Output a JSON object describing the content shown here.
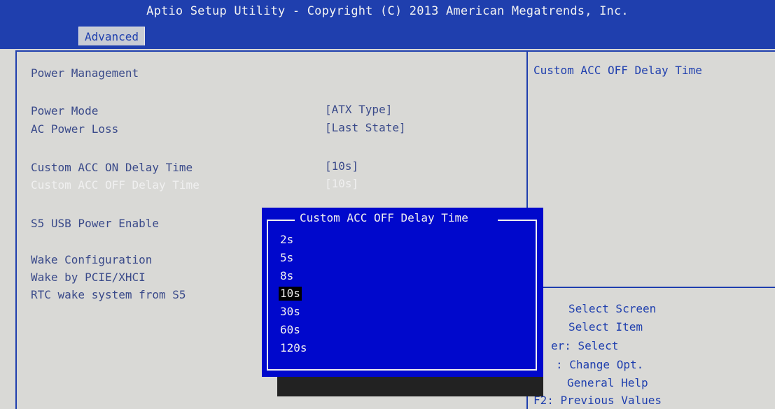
{
  "header": {
    "title": "Aptio Setup Utility - Copyright (C) 2013 American Megatrends, Inc.",
    "tab": "Advanced"
  },
  "main": {
    "section_title": "Power Management",
    "settings": [
      {
        "label": "Power Mode",
        "value": "[ATX Type]"
      },
      {
        "label": "AC Power Loss",
        "value": "[Last State]"
      },
      {
        "label": "Custom ACC ON Delay Time",
        "value": "[10s]"
      },
      {
        "label": "Custom ACC OFF Delay Time",
        "value": "[10s]"
      },
      {
        "label": "S5 USB Power Enable",
        "value": ""
      }
    ],
    "wake_title": "Wake Configuration",
    "wake_items": [
      {
        "label": "Wake by PCIE/XHCI"
      },
      {
        "label": "RTC wake system from S5"
      }
    ]
  },
  "help": {
    "description": "Custom ACC OFF Delay Time",
    "keys": [
      "Select Screen",
      "Select Item",
      "er: Select",
      ": Change Opt.",
      "General Help",
      "F2: Previous Values"
    ]
  },
  "popup": {
    "title": "Custom ACC OFF Delay Time",
    "options": [
      "2s",
      "5s",
      "8s",
      "10s",
      "30s",
      "60s",
      "120s"
    ],
    "selected": "10s"
  },
  "colors": {
    "header_bg": "#1f3fae",
    "popup_bg": "#0008cc",
    "screen_bg": "#d9d9d6"
  }
}
